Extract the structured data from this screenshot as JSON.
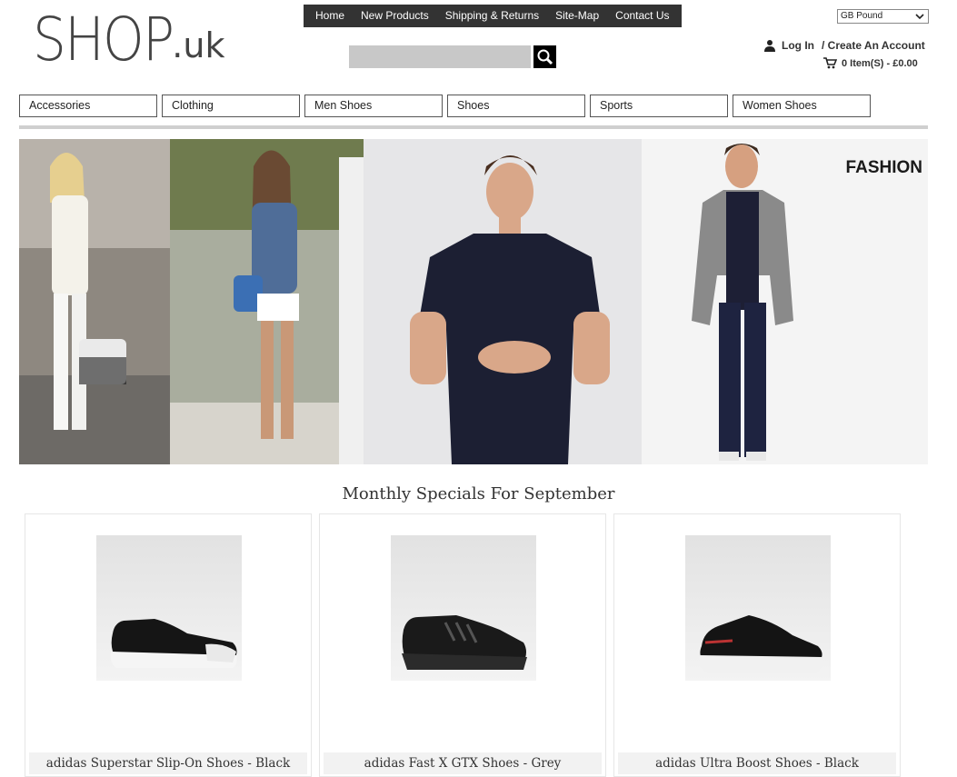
{
  "logo": {
    "main": "SHOP",
    "suffix": ".uk"
  },
  "topnav": [
    {
      "label": "Home"
    },
    {
      "label": "New Products"
    },
    {
      "label": "Shipping & Returns"
    },
    {
      "label": "Site-Map"
    },
    {
      "label": "Contact Us"
    }
  ],
  "currency": {
    "selected": "GB Pound"
  },
  "search": {
    "placeholder": ""
  },
  "account": {
    "login": "Log In",
    "create": "/ Create An Account",
    "cart": "0 Item(S) - £0.00"
  },
  "categories": [
    {
      "label": "Accessories"
    },
    {
      "label": "Clothing"
    },
    {
      "label": "Men Shoes"
    },
    {
      "label": "Shoes"
    },
    {
      "label": "Sports"
    },
    {
      "label": "Women Shoes"
    }
  ],
  "banner": {
    "tag": "FASHION"
  },
  "specials": {
    "heading": "Monthly Specials For September",
    "products": [
      {
        "name": "adidas Superstar Slip-On Shoes - Black"
      },
      {
        "name": "adidas Fast X GTX Shoes - Grey"
      },
      {
        "name": "adidas Ultra Boost Shoes - Black"
      }
    ]
  },
  "colors": {
    "nav_bg": "#333333",
    "search_bg": "#c8c8c8",
    "divider": "#cfcfcf"
  }
}
